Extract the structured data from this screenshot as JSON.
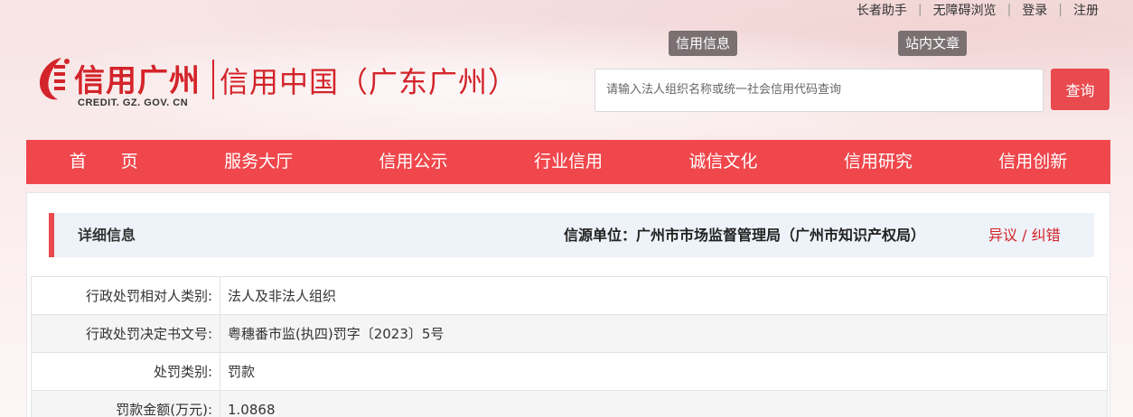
{
  "top_links": [
    "长者助手",
    "无障碍浏览",
    "登录",
    "注册"
  ],
  "logo": {
    "cn_name": "信用广州",
    "en_name": "CREDIT. GZ. GOV. CN",
    "site_name": "信用中国（广东广州）"
  },
  "search": {
    "tabs": [
      "信用信息",
      "站内文章"
    ],
    "placeholder": "请输入法人组织名称或统一社会信用代码查询",
    "button_label": "查询"
  },
  "nav": {
    "items": [
      "首　　页",
      "服务大厅",
      "信用公示",
      "行业信用",
      "诚信文化",
      "信用研究",
      "信用创新"
    ]
  },
  "detail": {
    "title": "详细信息",
    "source": "信源单位：广州市市场监督管理局（广州市知识产权局）",
    "objection_label": "异议 / 纠错",
    "rows": [
      {
        "label": "行政处罚相对人类别:",
        "value": "法人及非法人组织"
      },
      {
        "label": "行政处罚决定书文号:",
        "value": "粤穗番市监(执四)罚字〔2023〕5号"
      },
      {
        "label": "处罚类别:",
        "value": "罚款"
      },
      {
        "label": "罚款金额(万元):",
        "value": "1.0868"
      }
    ]
  },
  "colors": {
    "brand_red": "#e84a4f",
    "nav_red": "#f0474c",
    "logo_red": "#d3242a",
    "tab_gray": "#7a7072",
    "info_bar_bg": "#eef2f9"
  }
}
